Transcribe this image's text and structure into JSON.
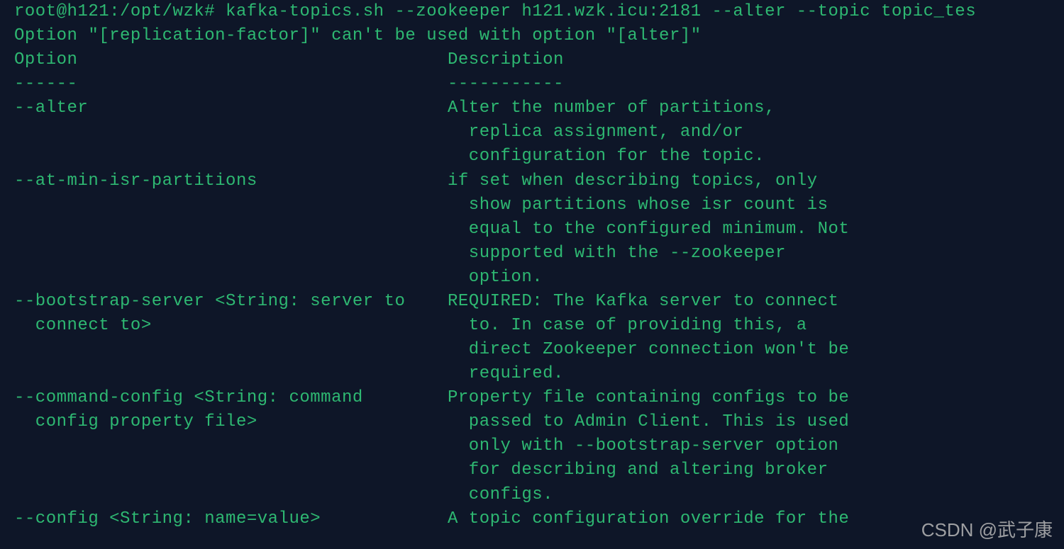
{
  "terminal": {
    "lines": [
      "root@h121:/opt/wzk# kafka-topics.sh --zookeeper h121.wzk.icu:2181 --alter --topic topic_tes",
      "Option \"[replication-factor]\" can't be used with option \"[alter]\"",
      "Option                                   Description",
      "------                                   -----------",
      "--alter                                  Alter the number of partitions,",
      "                                           replica assignment, and/or",
      "                                           configuration for the topic.",
      "--at-min-isr-partitions                  if set when describing topics, only",
      "                                           show partitions whose isr count is",
      "                                           equal to the configured minimum. Not",
      "                                           supported with the --zookeeper",
      "                                           option.",
      "--bootstrap-server <String: server to    REQUIRED: The Kafka server to connect",
      "  connect to>                              to. In case of providing this, a",
      "                                           direct Zookeeper connection won't be",
      "                                           required.",
      "--command-config <String: command        Property file containing configs to be",
      "  config property file>                    passed to Admin Client. This is used",
      "                                           only with --bootstrap-server option",
      "                                           for describing and altering broker",
      "                                           configs.",
      "--config <String: name=value>            A topic configuration override for the"
    ]
  },
  "watermark": {
    "text": "CSDN @武子康"
  }
}
